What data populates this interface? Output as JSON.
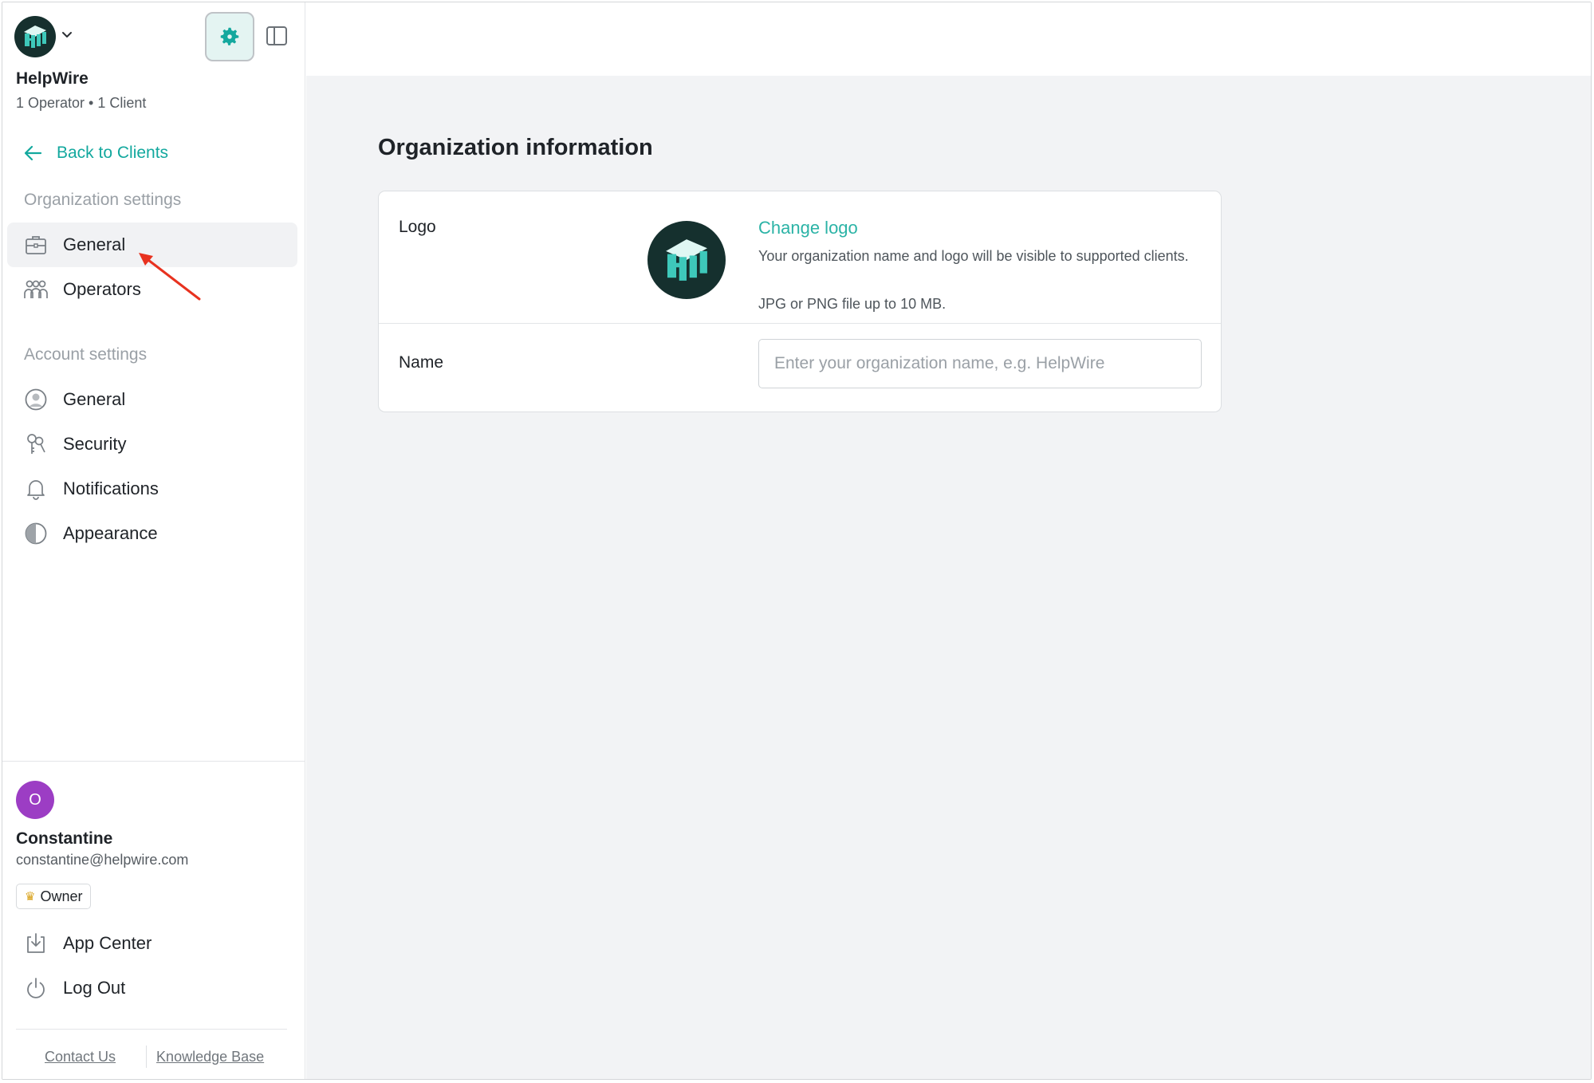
{
  "sidebar": {
    "org_name": "HelpWire",
    "org_meta": "1 Operator • 1 Client",
    "back_label": "Back to Clients",
    "org_section_title": "Organization settings",
    "org_items": [
      {
        "label": "General",
        "icon": "briefcase-icon",
        "active": true
      },
      {
        "label": "Operators",
        "icon": "users-icon",
        "active": false
      }
    ],
    "account_section_title": "Account settings",
    "account_items": [
      {
        "label": "General",
        "icon": "user-circle-icon"
      },
      {
        "label": "Security",
        "icon": "keys-icon"
      },
      {
        "label": "Notifications",
        "icon": "bell-icon"
      },
      {
        "label": "Appearance",
        "icon": "half-circle-icon"
      }
    ],
    "user": {
      "avatar_initial": "O",
      "name": "Constantine",
      "email": "constantine@helpwire.com",
      "role": "Owner"
    },
    "bottom_links": [
      {
        "label": "App Center",
        "icon": "download-icon"
      },
      {
        "label": "Log Out",
        "icon": "power-icon"
      }
    ],
    "footer": {
      "contact": "Contact Us",
      "kb": "Knowledge Base"
    }
  },
  "main": {
    "title": "Organization information",
    "logo_row": {
      "label": "Logo",
      "change_label": "Change logo",
      "description": "Your organization name and logo will be visible to supported clients.",
      "hint": "JPG or PNG file up to 10 MB."
    },
    "name_row": {
      "label": "Name",
      "value": "",
      "placeholder": "Enter your organization name, e.g. HelpWire"
    }
  },
  "colors": {
    "accent": "#13a89e",
    "avatar": "#9c3dc4",
    "active_bg": "#f1f2f4",
    "main_bg": "#f2f3f5",
    "annotation": "#e8321f"
  }
}
